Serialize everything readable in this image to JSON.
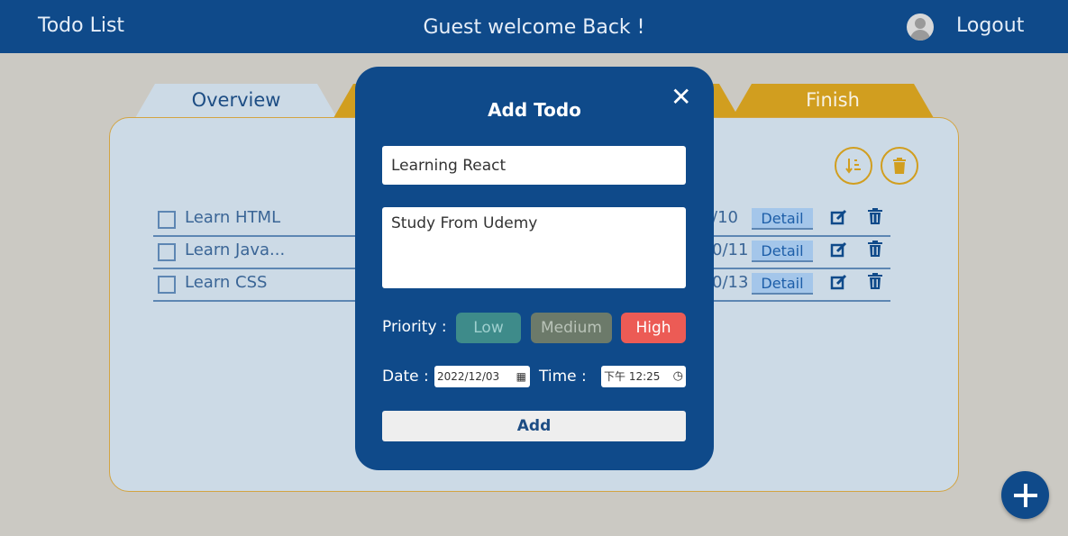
{
  "header": {
    "app_title": "Todo List",
    "welcome": "Guest welcome Back !",
    "logout_label": "Logout",
    "avatar_icon": "user-avatar-icon"
  },
  "tabs": [
    {
      "label": "Overview",
      "active": true
    },
    {
      "label": ""
    },
    {
      "label": "Finish"
    }
  ],
  "toolbar": {
    "sort_icon": "sort-down-icon",
    "delete_all_icon": "trash-icon"
  },
  "todos": [
    {
      "name": "Learn HTML",
      "date": "/10",
      "detail_label": "Detail"
    },
    {
      "name": "Learn Java...",
      "date": "0/11",
      "detail_label": "Detail"
    },
    {
      "name": "Learn CSS",
      "date": "0/13",
      "detail_label": "Detail"
    }
  ],
  "modal": {
    "title": "Add Todo",
    "close_icon": "close-icon",
    "title_value": "Learning React",
    "description_value": "Study From Udemy",
    "priority_label": "Priority :",
    "priorities": [
      "Low",
      "Medium",
      "High"
    ],
    "selected_priority": "High",
    "date_label": "Date :",
    "date_value": "2022/12/03",
    "time_label": "Time :",
    "time_value": "下午 12:25",
    "add_label": "Add"
  },
  "fab": {
    "icon": "plus-icon"
  },
  "colors": {
    "primary": "#0f4a8a",
    "accent": "#d19e1f",
    "panel": "#ccdae6",
    "background": "#cbc9c3",
    "low": "#3e8b8a",
    "medium": "#6c7a6a",
    "high": "#ec5b55"
  }
}
